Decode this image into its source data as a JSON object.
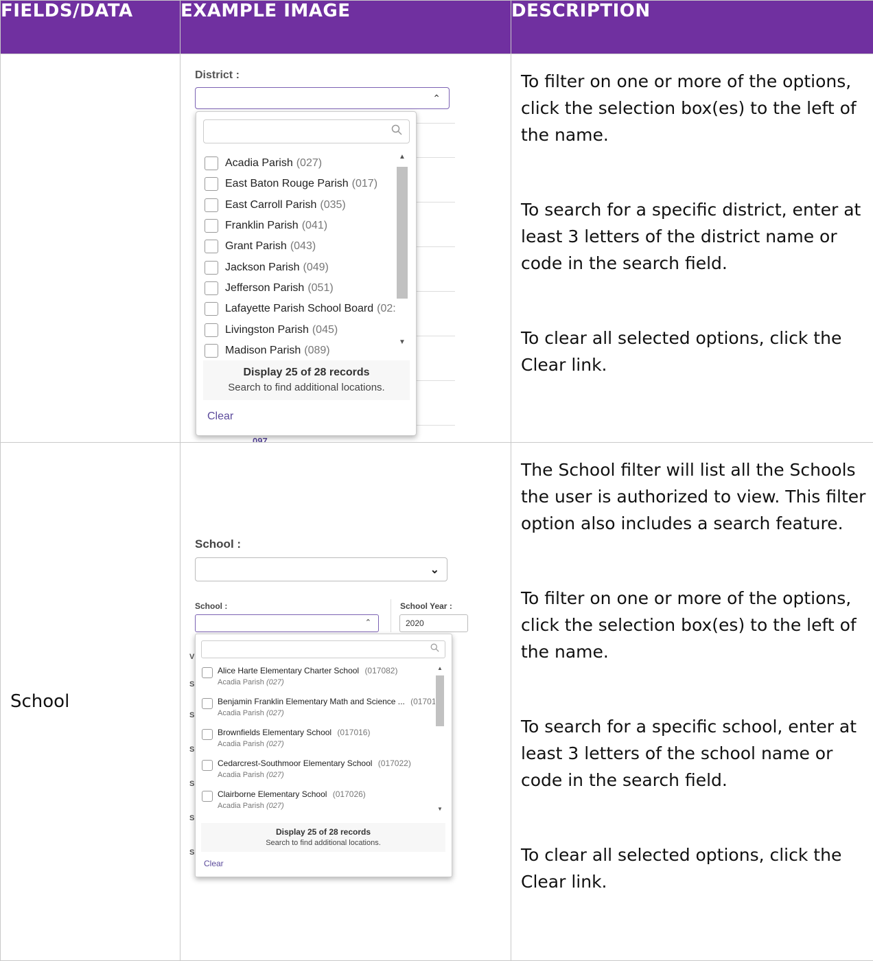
{
  "headers": [
    "FIELDS/DATA",
    "EXAMPLE IMAGE",
    "DESCRIPTION"
  ],
  "district": {
    "field": "",
    "label": "District :",
    "items": [
      {
        "name": "Acadia Parish",
        "code": "(027)"
      },
      {
        "name": "East Baton Rouge Parish",
        "code": "(017)"
      },
      {
        "name": "East Carroll Parish",
        "code": "(035)"
      },
      {
        "name": "Franklin Parish",
        "code": "(041)"
      },
      {
        "name": "Grant Parish",
        "code": "(043)"
      },
      {
        "name": "Jackson Parish",
        "code": "(049)"
      },
      {
        "name": "Jefferson Parish",
        "code": "(051)"
      },
      {
        "name": "Lafayette Parish School Board",
        "code": "(02:"
      },
      {
        "name": "Livingston Parish",
        "code": "(045)"
      },
      {
        "name": "Madison Parish",
        "code": "(089)"
      }
    ],
    "footer_count": "Display 25 of 28 records",
    "footer_hint": "Search to find additional locations.",
    "clear": "Clear",
    "behind_text": "097",
    "description": [
      "To filter on one or more of the options, click the selection box(es) to the left of the name.",
      "To search for a specific district, enter at least 3 letters of the district name or code in the search field.",
      "To clear all selected options, click the Clear link."
    ]
  },
  "school": {
    "field": "School",
    "label_big": "School :",
    "label_small": "School :",
    "year_label": "School Year :",
    "year_value": "2020",
    "items": [
      {
        "name": "Alice Harte Elementary Charter School",
        "code": "(017082)",
        "district": "Acadia Parish",
        "dcode": "(027)"
      },
      {
        "name": "Benjamin Franklin Elementary Math and Science ...",
        "code": "(01701",
        "district": "Acadia Parish",
        "dcode": "(027)"
      },
      {
        "name": "Brownfields Elementary School",
        "code": "(017016)",
        "district": "Acadia Parish",
        "dcode": "(027)"
      },
      {
        "name": "Cedarcrest-Southmoor Elementary School",
        "code": "(017022)",
        "district": "Acadia Parish",
        "dcode": "(027)"
      },
      {
        "name": "Clairborne Elementary School",
        "code": "(017026)",
        "district": "Acadia Parish",
        "dcode": "(027)"
      }
    ],
    "footer_count": "Display 25 of 28 records",
    "footer_hint": "Search to find additional locations.",
    "clear": "Clear",
    "description": [
      "The School filter will list all the Schools the user is authorized to view. This filter option also includes a search feature.",
      "To filter on one or more of the options, click the selection box(es) to the left of the name.",
      "To search for a specific school, enter at least 3 letters of the school name or code in the search field.",
      "To clear all selected options, click the Clear link."
    ]
  },
  "icons": {
    "search": "search-icon",
    "caret_up": "caret-up-icon",
    "chevron_down": "chevron-down-icon"
  }
}
